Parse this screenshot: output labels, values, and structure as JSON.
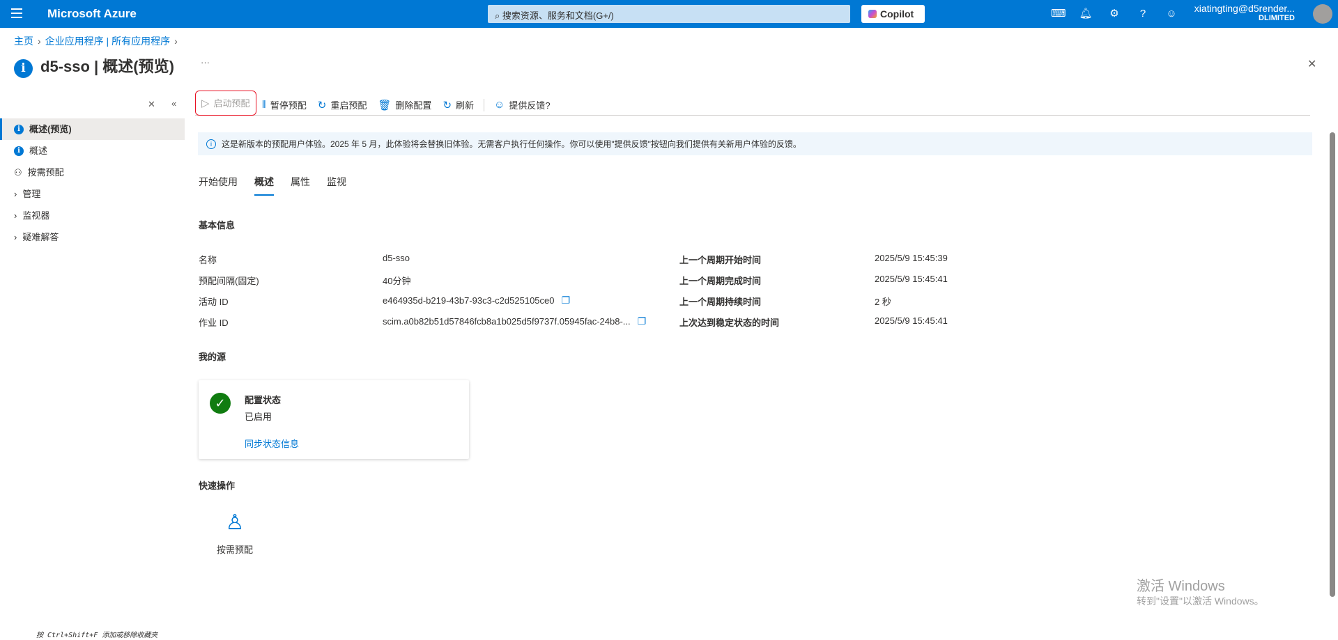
{
  "topbar": {
    "brand": "Microsoft Azure",
    "search_placeholder": "搜索资源、服务和文档(G+/)",
    "copilot": "Copilot",
    "user": "xiatingting@d5render...",
    "org": "DLIMITED"
  },
  "breadcrumb": [
    "主页",
    "企业应用程序 | 所有应用程序"
  ],
  "title": "d5-sso | 概述(预览)",
  "more": "···",
  "close": "✕",
  "sidebar": {
    "items": [
      {
        "label": "概述(预览)"
      },
      {
        "label": "概述"
      },
      {
        "label": "按需预配"
      },
      {
        "label": "管理"
      },
      {
        "label": "监视器"
      },
      {
        "label": "疑难解答"
      }
    ]
  },
  "toolbar": {
    "start": "启动预配",
    "pause": "暂停预配",
    "restart": "重启预配",
    "delete": "删除配置",
    "refresh": "刷新",
    "feedback": "提供反馈?"
  },
  "banner": "这是新版本的预配用户体验。2025 年 5 月，此体验将会替换旧体验。无需客户执行任何操作。你可以使用\"提供反馈\"按钮向我们提供有关新用户体验的反馈。",
  "tabs": [
    "开始使用",
    "概述",
    "属性",
    "监视"
  ],
  "basic": {
    "heading": "基本信息",
    "left": [
      {
        "label": "名称",
        "value": "d5-sso"
      },
      {
        "label": "预配间隔(固定)",
        "value": "40分钟"
      },
      {
        "label": "活动 ID",
        "value": "e464935d-b219-43b7-93c3-c2d525105ce0"
      },
      {
        "label": "作业 ID",
        "value": "scim.a0b82b51d57846fcb8a1b025d5f9737f.05945fac-24b8-..."
      }
    ],
    "right": [
      {
        "label": "上一个周期开始时间",
        "value": "2025/5/9 15:45:39"
      },
      {
        "label": "上一个周期完成时间",
        "value": "2025/5/9 15:45:41"
      },
      {
        "label": "上一个周期持续时间",
        "value": "2 秒"
      },
      {
        "label": "上次达到稳定状态的时间",
        "value": "2025/5/9 15:45:41"
      }
    ]
  },
  "source": {
    "heading": "我的源",
    "card_title": "配置状态",
    "card_status": "已启用",
    "card_link": "同步状态信息"
  },
  "quick": {
    "heading": "快速操作",
    "item": "按需预配"
  },
  "watermark": {
    "line1": "激活 Windows",
    "line2": "转到\"设置\"以激活 Windows。"
  },
  "footer": "按 Ctrl+Shift+F 添加或移除收藏夹"
}
